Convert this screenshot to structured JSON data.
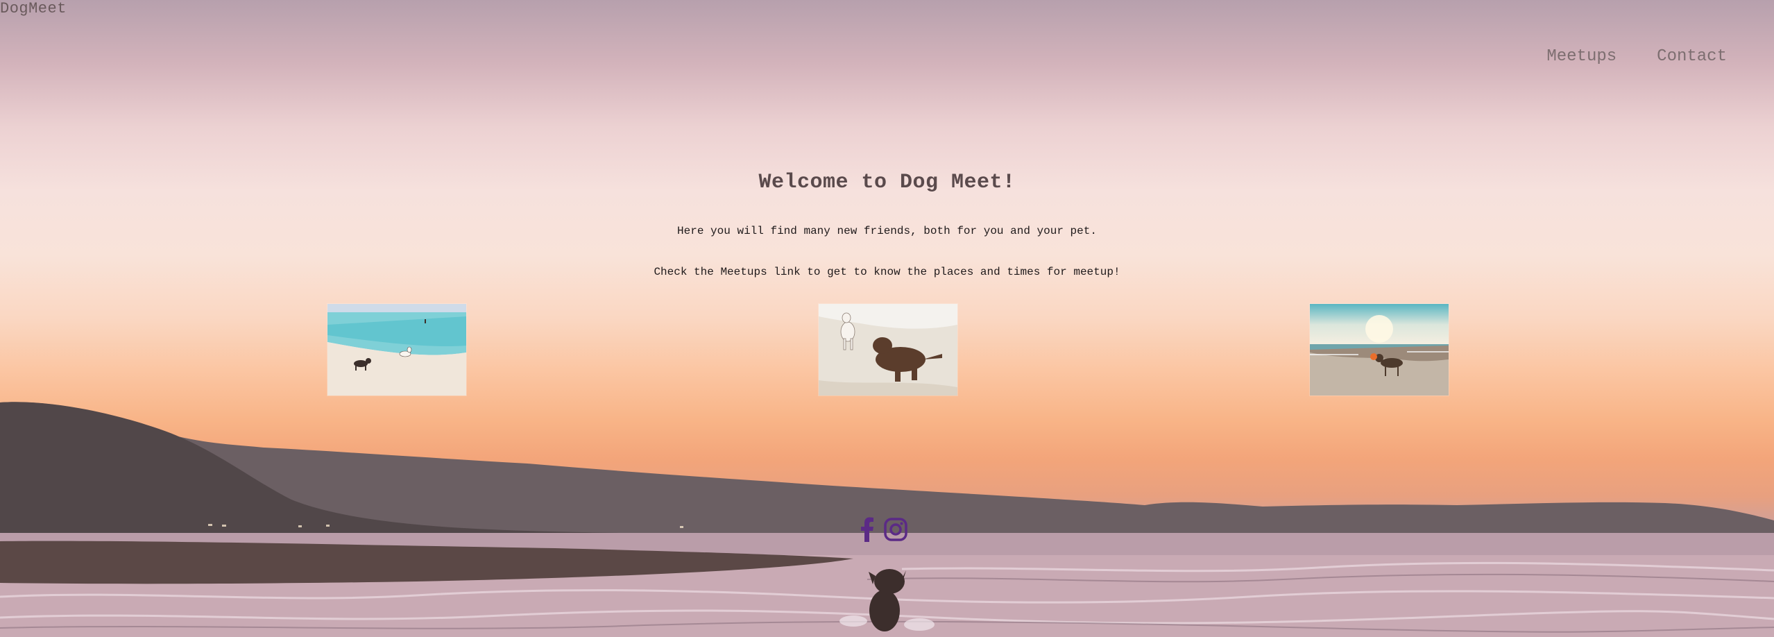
{
  "brand": {
    "name": "DogMeet"
  },
  "nav": {
    "items": [
      {
        "label": "Meetups"
      },
      {
        "label": "Contact"
      }
    ]
  },
  "hero": {
    "title": "Welcome to Dog Meet!",
    "lines": [
      "Here you will find many new friends, both for you and your pet.",
      "Check the Meetups link to get to know the places and times for meetup!"
    ]
  },
  "gallery": {
    "photos": [
      {
        "icon": "beach-dogs-photo"
      },
      {
        "icon": "sand-dogs-photo"
      },
      {
        "icon": "sunset-dog-photo"
      }
    ]
  },
  "social": {
    "items": [
      {
        "icon": "facebook-icon"
      },
      {
        "icon": "instagram-icon"
      }
    ]
  },
  "colors": {
    "accent": "#5b2a86",
    "text": "#5a4a4c"
  }
}
